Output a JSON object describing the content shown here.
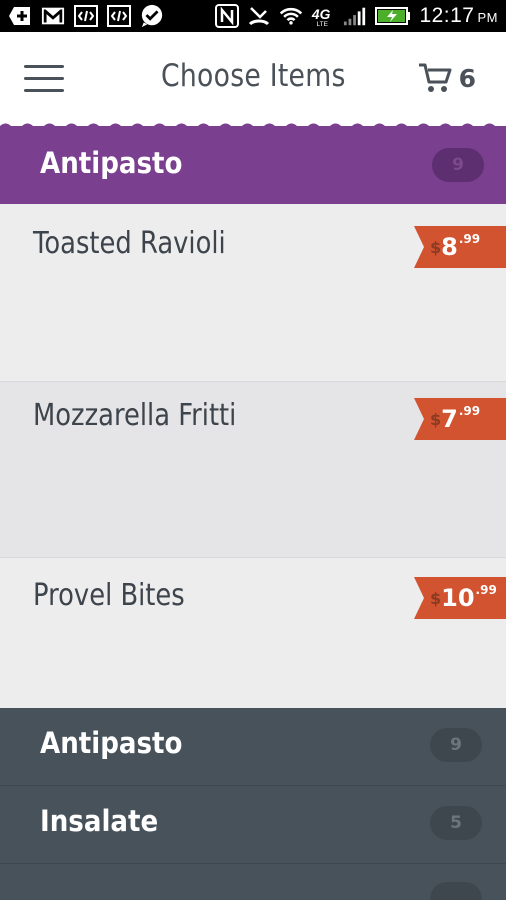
{
  "status_bar": {
    "time": "12:17",
    "ampm": "PM",
    "network": "4G LTE",
    "icons": [
      "plus-icon",
      "gmail-icon",
      "code-icon",
      "code-icon",
      "check-bubble-icon",
      "nfc-icon",
      "missed-call-icon",
      "wifi-icon",
      "network-4g-icon",
      "signal-icon",
      "battery-charging-icon"
    ]
  },
  "app_bar": {
    "title": "Choose Items",
    "cart_count": "6",
    "menu_icon": "hamburger-icon",
    "cart_icon": "cart-icon"
  },
  "active_category": {
    "name": "Antipasto",
    "count": "9",
    "color": "#7a3f8e"
  },
  "items": [
    {
      "name": "Toasted Ravioli",
      "currency": "$",
      "dollars": "8",
      "cents": ".99"
    },
    {
      "name": "Mozzarella Fritti",
      "currency": "$",
      "dollars": "7",
      "cents": ".99"
    },
    {
      "name": "Provel Bites",
      "currency": "$",
      "dollars": "10",
      "cents": ".99"
    }
  ],
  "categories": [
    {
      "name": "Antipasto",
      "count": "9"
    },
    {
      "name": "Insalate",
      "count": "5"
    }
  ],
  "colors": {
    "price_tag": "#d2532f",
    "drawer_bg": "#48525a",
    "text_dark": "#4a5158"
  }
}
